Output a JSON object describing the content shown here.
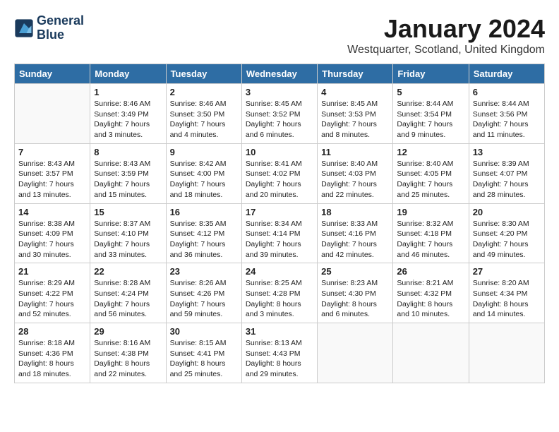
{
  "header": {
    "logo_line1": "General",
    "logo_line2": "Blue",
    "month": "January 2024",
    "location": "Westquarter, Scotland, United Kingdom"
  },
  "days_of_week": [
    "Sunday",
    "Monday",
    "Tuesday",
    "Wednesday",
    "Thursday",
    "Friday",
    "Saturday"
  ],
  "weeks": [
    [
      {
        "day": "",
        "sunrise": "",
        "sunset": "",
        "daylight": ""
      },
      {
        "day": "1",
        "sunrise": "Sunrise: 8:46 AM",
        "sunset": "Sunset: 3:49 PM",
        "daylight": "Daylight: 7 hours and 3 minutes."
      },
      {
        "day": "2",
        "sunrise": "Sunrise: 8:46 AM",
        "sunset": "Sunset: 3:50 PM",
        "daylight": "Daylight: 7 hours and 4 minutes."
      },
      {
        "day": "3",
        "sunrise": "Sunrise: 8:45 AM",
        "sunset": "Sunset: 3:52 PM",
        "daylight": "Daylight: 7 hours and 6 minutes."
      },
      {
        "day": "4",
        "sunrise": "Sunrise: 8:45 AM",
        "sunset": "Sunset: 3:53 PM",
        "daylight": "Daylight: 7 hours and 8 minutes."
      },
      {
        "day": "5",
        "sunrise": "Sunrise: 8:44 AM",
        "sunset": "Sunset: 3:54 PM",
        "daylight": "Daylight: 7 hours and 9 minutes."
      },
      {
        "day": "6",
        "sunrise": "Sunrise: 8:44 AM",
        "sunset": "Sunset: 3:56 PM",
        "daylight": "Daylight: 7 hours and 11 minutes."
      }
    ],
    [
      {
        "day": "7",
        "sunrise": "Sunrise: 8:43 AM",
        "sunset": "Sunset: 3:57 PM",
        "daylight": "Daylight: 7 hours and 13 minutes."
      },
      {
        "day": "8",
        "sunrise": "Sunrise: 8:43 AM",
        "sunset": "Sunset: 3:59 PM",
        "daylight": "Daylight: 7 hours and 15 minutes."
      },
      {
        "day": "9",
        "sunrise": "Sunrise: 8:42 AM",
        "sunset": "Sunset: 4:00 PM",
        "daylight": "Daylight: 7 hours and 18 minutes."
      },
      {
        "day": "10",
        "sunrise": "Sunrise: 8:41 AM",
        "sunset": "Sunset: 4:02 PM",
        "daylight": "Daylight: 7 hours and 20 minutes."
      },
      {
        "day": "11",
        "sunrise": "Sunrise: 8:40 AM",
        "sunset": "Sunset: 4:03 PM",
        "daylight": "Daylight: 7 hours and 22 minutes."
      },
      {
        "day": "12",
        "sunrise": "Sunrise: 8:40 AM",
        "sunset": "Sunset: 4:05 PM",
        "daylight": "Daylight: 7 hours and 25 minutes."
      },
      {
        "day": "13",
        "sunrise": "Sunrise: 8:39 AM",
        "sunset": "Sunset: 4:07 PM",
        "daylight": "Daylight: 7 hours and 28 minutes."
      }
    ],
    [
      {
        "day": "14",
        "sunrise": "Sunrise: 8:38 AM",
        "sunset": "Sunset: 4:09 PM",
        "daylight": "Daylight: 7 hours and 30 minutes."
      },
      {
        "day": "15",
        "sunrise": "Sunrise: 8:37 AM",
        "sunset": "Sunset: 4:10 PM",
        "daylight": "Daylight: 7 hours and 33 minutes."
      },
      {
        "day": "16",
        "sunrise": "Sunrise: 8:35 AM",
        "sunset": "Sunset: 4:12 PM",
        "daylight": "Daylight: 7 hours and 36 minutes."
      },
      {
        "day": "17",
        "sunrise": "Sunrise: 8:34 AM",
        "sunset": "Sunset: 4:14 PM",
        "daylight": "Daylight: 7 hours and 39 minutes."
      },
      {
        "day": "18",
        "sunrise": "Sunrise: 8:33 AM",
        "sunset": "Sunset: 4:16 PM",
        "daylight": "Daylight: 7 hours and 42 minutes."
      },
      {
        "day": "19",
        "sunrise": "Sunrise: 8:32 AM",
        "sunset": "Sunset: 4:18 PM",
        "daylight": "Daylight: 7 hours and 46 minutes."
      },
      {
        "day": "20",
        "sunrise": "Sunrise: 8:30 AM",
        "sunset": "Sunset: 4:20 PM",
        "daylight": "Daylight: 7 hours and 49 minutes."
      }
    ],
    [
      {
        "day": "21",
        "sunrise": "Sunrise: 8:29 AM",
        "sunset": "Sunset: 4:22 PM",
        "daylight": "Daylight: 7 hours and 52 minutes."
      },
      {
        "day": "22",
        "sunrise": "Sunrise: 8:28 AM",
        "sunset": "Sunset: 4:24 PM",
        "daylight": "Daylight: 7 hours and 56 minutes."
      },
      {
        "day": "23",
        "sunrise": "Sunrise: 8:26 AM",
        "sunset": "Sunset: 4:26 PM",
        "daylight": "Daylight: 7 hours and 59 minutes."
      },
      {
        "day": "24",
        "sunrise": "Sunrise: 8:25 AM",
        "sunset": "Sunset: 4:28 PM",
        "daylight": "Daylight: 8 hours and 3 minutes."
      },
      {
        "day": "25",
        "sunrise": "Sunrise: 8:23 AM",
        "sunset": "Sunset: 4:30 PM",
        "daylight": "Daylight: 8 hours and 6 minutes."
      },
      {
        "day": "26",
        "sunrise": "Sunrise: 8:21 AM",
        "sunset": "Sunset: 4:32 PM",
        "daylight": "Daylight: 8 hours and 10 minutes."
      },
      {
        "day": "27",
        "sunrise": "Sunrise: 8:20 AM",
        "sunset": "Sunset: 4:34 PM",
        "daylight": "Daylight: 8 hours and 14 minutes."
      }
    ],
    [
      {
        "day": "28",
        "sunrise": "Sunrise: 8:18 AM",
        "sunset": "Sunset: 4:36 PM",
        "daylight": "Daylight: 8 hours and 18 minutes."
      },
      {
        "day": "29",
        "sunrise": "Sunrise: 8:16 AM",
        "sunset": "Sunset: 4:38 PM",
        "daylight": "Daylight: 8 hours and 22 minutes."
      },
      {
        "day": "30",
        "sunrise": "Sunrise: 8:15 AM",
        "sunset": "Sunset: 4:41 PM",
        "daylight": "Daylight: 8 hours and 25 minutes."
      },
      {
        "day": "31",
        "sunrise": "Sunrise: 8:13 AM",
        "sunset": "Sunset: 4:43 PM",
        "daylight": "Daylight: 8 hours and 29 minutes."
      },
      {
        "day": "",
        "sunrise": "",
        "sunset": "",
        "daylight": ""
      },
      {
        "day": "",
        "sunrise": "",
        "sunset": "",
        "daylight": ""
      },
      {
        "day": "",
        "sunrise": "",
        "sunset": "",
        "daylight": ""
      }
    ]
  ]
}
